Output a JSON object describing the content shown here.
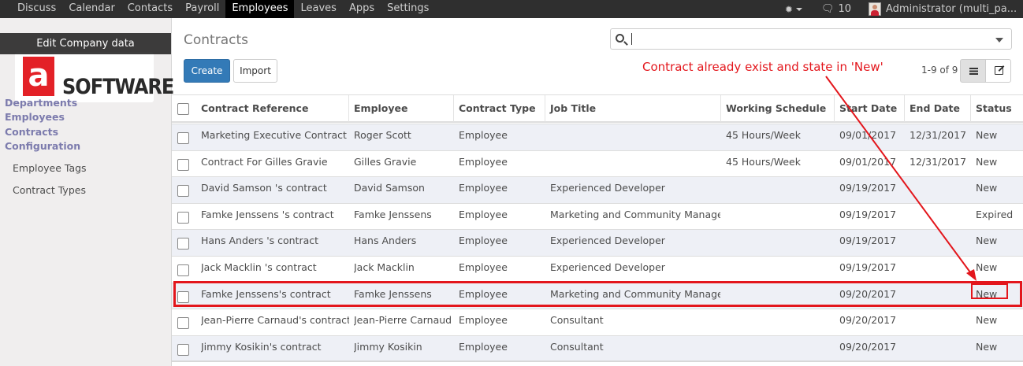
{
  "topbar": {
    "menu": [
      "Discuss",
      "Calendar",
      "Contacts",
      "Payroll",
      "Employees",
      "Leaves",
      "Apps",
      "Settings"
    ],
    "active": "Employees",
    "message_count": "10",
    "user_label": "Administrator (multi_pa..."
  },
  "sidebar": {
    "edit_company_label": "Edit Company data",
    "logo_text": "SOFTWARE",
    "logo_mark": "a",
    "sections": [
      "Departments",
      "Employees",
      "Contracts",
      "Configuration"
    ],
    "sub_items": [
      "Employee Tags",
      "Contract Types"
    ]
  },
  "control": {
    "breadcrumb": "Contracts",
    "create_label": "Create",
    "import_label": "Import",
    "pager": "1-9 of 9"
  },
  "table": {
    "columns": [
      "Contract Reference",
      "Employee",
      "Contract Type",
      "Job Title",
      "Working Schedule",
      "Start Date",
      "End Date",
      "Status"
    ],
    "rows": [
      {
        "ref": "Marketing Executive Contract",
        "employee": "Roger Scott",
        "type": "Employee",
        "job": "",
        "schedule": "45 Hours/Week",
        "start": "09/01/2017",
        "end": "12/31/2017",
        "status": "New"
      },
      {
        "ref": "Contract For Gilles Gravie",
        "employee": "Gilles Gravie",
        "type": "Employee",
        "job": "",
        "schedule": "45 Hours/Week",
        "start": "09/01/2017",
        "end": "12/31/2017",
        "status": "New"
      },
      {
        "ref": "David Samson 's contract",
        "employee": "David Samson",
        "type": "Employee",
        "job": "Experienced Developer",
        "schedule": "",
        "start": "09/19/2017",
        "end": "",
        "status": "New"
      },
      {
        "ref": "Famke Jenssens 's contract",
        "employee": "Famke Jenssens",
        "type": "Employee",
        "job": "Marketing and Community Manager",
        "schedule": "",
        "start": "09/19/2017",
        "end": "",
        "status": "Expired"
      },
      {
        "ref": "Hans Anders 's contract",
        "employee": "Hans Anders",
        "type": "Employee",
        "job": "Experienced Developer",
        "schedule": "",
        "start": "09/19/2017",
        "end": "",
        "status": "New"
      },
      {
        "ref": "Jack Macklin 's contract",
        "employee": "Jack Macklin",
        "type": "Employee",
        "job": "Experienced Developer",
        "schedule": "",
        "start": "09/19/2017",
        "end": "",
        "status": "New"
      },
      {
        "ref": "Famke Jenssens's contract",
        "employee": "Famke Jenssens",
        "type": "Employee",
        "job": "Marketing and Community Manager",
        "schedule": "",
        "start": "09/20/2017",
        "end": "",
        "status": "New"
      },
      {
        "ref": "Jean-Pierre Carnaud's contract",
        "employee": "Jean-Pierre Carnaud",
        "type": "Employee",
        "job": "Consultant",
        "schedule": "",
        "start": "09/20/2017",
        "end": "",
        "status": "New"
      },
      {
        "ref": "Jimmy Kosikin's contract",
        "employee": "Jimmy Kosikin",
        "type": "Employee",
        "job": "Consultant",
        "schedule": "",
        "start": "09/20/2017",
        "end": "",
        "status": "New"
      }
    ]
  },
  "annotation": {
    "text": "Contract already exist and state in 'New'",
    "color": "#e3161c"
  },
  "colors": {
    "navbar": "#2f2f2f",
    "primary_button": "#337ab7",
    "sidebar_heading": "#7c7bad",
    "odd_row": "#eef0f6"
  }
}
